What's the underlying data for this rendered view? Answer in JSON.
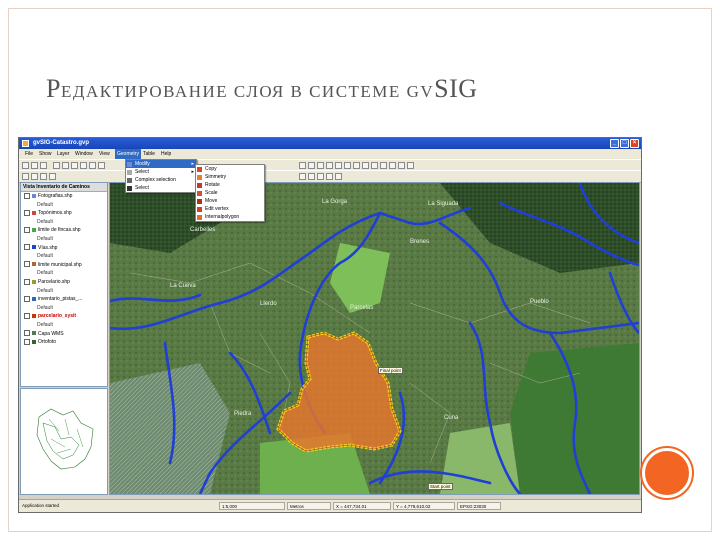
{
  "slide": {
    "title_first": "Р",
    "title_rest": "ЕДАКТИРОВАНИЕ СЛОЯ В СИСТЕМЕ ",
    "title_gv": "GV",
    "title_sig": "SIG",
    "accent_color": "#f26522"
  },
  "app": {
    "window_title": "gvSIG-Catastro.gvp",
    "menus": [
      "File",
      "Show",
      "Layer",
      "Window",
      "View",
      "Geometry",
      "Table",
      "Help"
    ],
    "active_menu": "Geometry",
    "geometry_menu": [
      {
        "label": "Modify",
        "icon": "modify-icon",
        "submenu": true
      },
      {
        "label": "Select",
        "icon": "select-icon",
        "submenu": true
      },
      {
        "label": "Complex selection",
        "icon": "complex-selection-icon",
        "submenu": false
      },
      {
        "label": "Select",
        "icon": "arrow-select-icon",
        "submenu": false
      }
    ],
    "modify_submenu": [
      {
        "label": "Copy",
        "icon": "copy-icon"
      },
      {
        "label": "Simmetry",
        "icon": "symmetry-icon"
      },
      {
        "label": "Rotate",
        "icon": "rotate-icon"
      },
      {
        "label": "Scale",
        "icon": "scale-icon"
      },
      {
        "label": "Move",
        "icon": "move-icon"
      },
      {
        "label": "Edit vertex",
        "icon": "edit-vertex-icon"
      },
      {
        "label": "Internalpolygon",
        "icon": "internal-polygon-icon"
      }
    ],
    "toc_header": "Vista Inventario de Caminos",
    "layers": [
      {
        "label": "Fotografias.shp",
        "sub": "Default",
        "color": "#6688cc"
      },
      {
        "label": "Topónimos.shp",
        "sub": "Default",
        "color": "#cc4444"
      },
      {
        "label": "limite de fincas.shp",
        "sub": "Default",
        "color": "#44aa44"
      },
      {
        "label": "Vías.shp",
        "sub": "Default",
        "color": "#2244cc"
      },
      {
        "label": "limite municipal.shp",
        "sub": "Default",
        "color": "#aa6633"
      },
      {
        "label": "Parcelario.shp",
        "sub": "Default",
        "color": "#999933"
      },
      {
        "label": "inventario_pistas_...",
        "sub": "Default",
        "color": "#3366aa"
      },
      {
        "label": "parcelario_sysit",
        "sub": "Default",
        "color": "#cc3300",
        "editing": true
      },
      {
        "label": "Capa WMS",
        "sub": "",
        "color": "#557755"
      },
      {
        "label": "Ortofoto",
        "sub": "",
        "color": "#336633"
      }
    ],
    "map_labels": [
      "La Gorga",
      "Brenes",
      "Carbelles",
      "La Siguada",
      "La Cueva",
      "Pueblo",
      "Parcelas",
      "Llerdo",
      "Piedra",
      "Cuna"
    ],
    "callouts": [
      "Final point",
      "Start point"
    ],
    "status": {
      "message": "Application started",
      "scale": "1:5,000",
      "units": "Metros",
      "x": "X = 447,734.01",
      "y": "Y = 4,779,610.02",
      "crs": "EPSG:23030"
    }
  }
}
